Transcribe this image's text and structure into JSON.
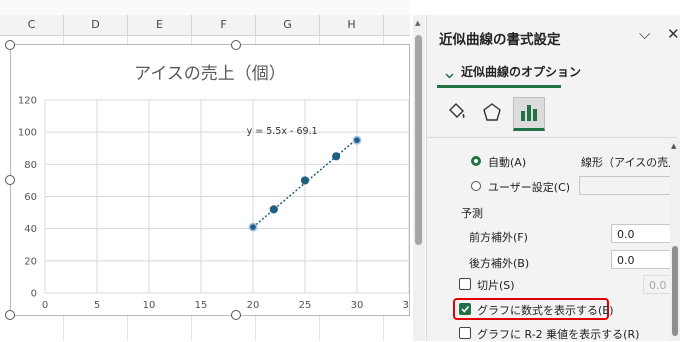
{
  "spreadsheet": {
    "columns": [
      "C",
      "D",
      "E",
      "F",
      "G",
      "H"
    ]
  },
  "chart": {
    "title": "アイスの売上（個）"
  },
  "chart_data": {
    "type": "scatter",
    "title": "アイスの売上（個）",
    "xlabel": "",
    "ylabel": "",
    "xlim": [
      0,
      35
    ],
    "ylim": [
      0,
      120
    ],
    "xticks": [
      0,
      5,
      10,
      15,
      20,
      25,
      30,
      35
    ],
    "yticks": [
      0,
      20,
      40,
      60,
      80,
      100,
      120
    ],
    "grid": true,
    "series": [
      {
        "x": [
          20,
          22,
          25,
          28,
          30
        ],
        "y": [
          41,
          52,
          70,
          85,
          95
        ]
      }
    ],
    "trendline": {
      "type": "linear",
      "slope": 5.5,
      "intercept": -69.1,
      "label": "y = 5.5x - 69.1"
    }
  },
  "pane": {
    "title": "近似曲線の書式設定",
    "section": "近似曲線のオプション",
    "auto_label": "自動(A)",
    "auto_value": "線形（アイスの売上",
    "custom_label": "ユーザー設定(C)",
    "forecast_label": "予測",
    "forward_label": "前方補外(F)",
    "forward_value": "0.0",
    "backward_label": "後方補外(B)",
    "backward_value": "0.0",
    "intercept_label": "切片(S)",
    "intercept_value": "0.0",
    "show_equation_label": "グラフに数式を表示する(E)",
    "show_r2_label": "グラフに R-2 乗値を表示する(R)"
  },
  "colors": {
    "marker": "#1f5f7f",
    "trendline": "#1f5f7f",
    "accent": "#217346",
    "highlight": "#e00000"
  }
}
